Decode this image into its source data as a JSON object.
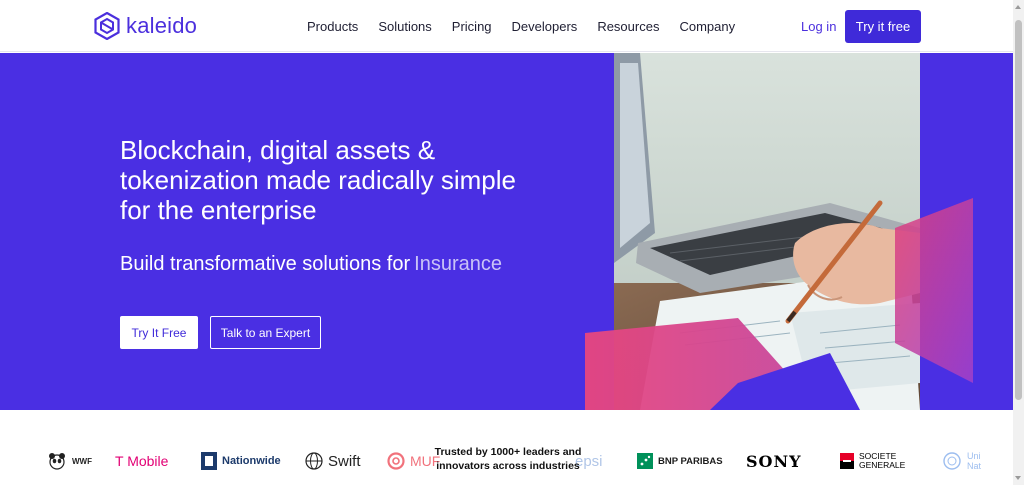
{
  "brand": {
    "name": "kaleido",
    "accent": "#4b2fdd",
    "hero_bg": "#4a2fe3"
  },
  "nav": {
    "links": [
      "Products",
      "Solutions",
      "Pricing",
      "Developers",
      "Resources",
      "Company"
    ],
    "login": "Log in",
    "cta": "Try it free"
  },
  "hero": {
    "title": "Blockchain, digital assets & tokenization made radically simple for the enterprise",
    "subtitle": "Build transformative solutions for",
    "rotating_word": "Insurance",
    "primary_button": "Try It Free",
    "secondary_button": "Talk to an Expert"
  },
  "logos": {
    "items": [
      "WWF",
      "T Mobile",
      "Nationwide",
      "Swift",
      "MUF",
      "epsi",
      "BNP PARIBAS",
      "SONY",
      "SOCIETE GENERALE",
      "Uni Nat"
    ],
    "trusted_text": "Trusted by 1000+ leaders and innovators across industries"
  }
}
